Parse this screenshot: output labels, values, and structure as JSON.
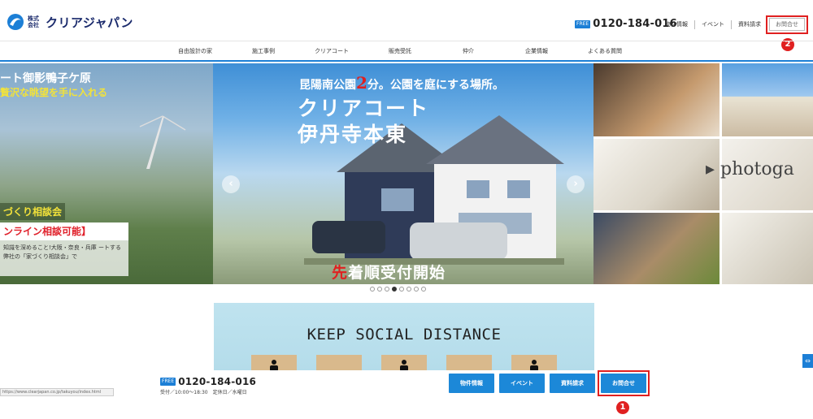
{
  "header": {
    "logo_small": "株式会社",
    "logo_main": "クリアジャパン",
    "free_dial": "FREE",
    "tel": "0120-184-016",
    "links": [
      "物件情報",
      "イベント",
      "資料請求"
    ],
    "contact": "お問合せ"
  },
  "nav": {
    "items": [
      "自由設計の家",
      "施工事例",
      "クリアコート",
      "販売受託",
      "仲介",
      "企業情報",
      "よくある質問"
    ]
  },
  "slider": {
    "left": {
      "line1": "ート御影鴨子ケ原",
      "line2": "贅沢な眺望を手に入れる",
      "badge": "づくり相談会",
      "box": "ンライン相談可能】",
      "desc": "知識を深めること!大阪・奈良・兵庫 ートする弊社の「家づくり相談会」で"
    },
    "main": {
      "top_pre": "昆陽南公園",
      "top_num": "2",
      "top_post": "分。公園を庭にする場所。",
      "title1": "クリアコート",
      "title2": "伊丹寺本東",
      "bottom_red": "先",
      "bottom_rest": "着順受付開始"
    },
    "right_label": "▸ photoga",
    "prev": "‹",
    "next": "›",
    "dot_count": 8,
    "active_dot": 3
  },
  "banner": {
    "text": "KEEP SOCIAL DISTANCE"
  },
  "footer": {
    "free_dial": "FREE",
    "tel": "0120-184-016",
    "hours": "受付／10:00〜18:30　定休日／水曜日",
    "buttons": [
      "物件情報",
      "イベント",
      "資料請求",
      "お問合せ"
    ]
  },
  "annotations": [
    "1",
    "2"
  ],
  "status_url": "https://www.clearjapan.co.jp/takuyou/index.html"
}
